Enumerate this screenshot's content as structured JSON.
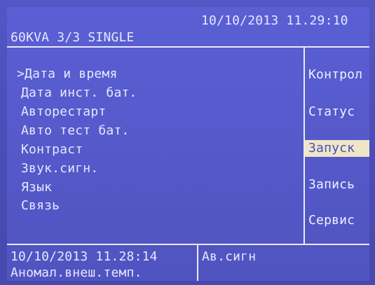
{
  "header": {
    "datetime": "10/10/2013 11.29:10",
    "model": "60KVA 3/3  SINGLE"
  },
  "menu": {
    "items": [
      {
        "label": ">Дата и время",
        "selected": true
      },
      {
        "label": "Дата инст. бат.",
        "selected": false
      },
      {
        "label": "Авторестарт",
        "selected": false
      },
      {
        "label": "Авто тест бат.",
        "selected": false
      },
      {
        "label": "Контраст",
        "selected": false
      },
      {
        "label": "Звук.сигн.",
        "selected": false
      },
      {
        "label": "Язык",
        "selected": false
      },
      {
        "label": "Связь",
        "selected": false
      }
    ]
  },
  "side_menu": {
    "items": [
      {
        "label": "Контрол",
        "highlighted": false
      },
      {
        "label": "Статус",
        "highlighted": false
      },
      {
        "label": "Запуск",
        "highlighted": true
      },
      {
        "label": "Запись",
        "highlighted": false
      },
      {
        "label": "Сервис",
        "highlighted": false
      }
    ]
  },
  "status_bar": {
    "datetime": "10/10/2013  11.28:14",
    "alarm": "Ав.сигн",
    "message": "Аномал.внеш.темп."
  },
  "colors": {
    "background": "#5559ca",
    "text": "#e6e8ff",
    "highlight_bg": "#efe6c8",
    "highlight_text": "#4b4fb8",
    "lines": "#ece9f2"
  }
}
